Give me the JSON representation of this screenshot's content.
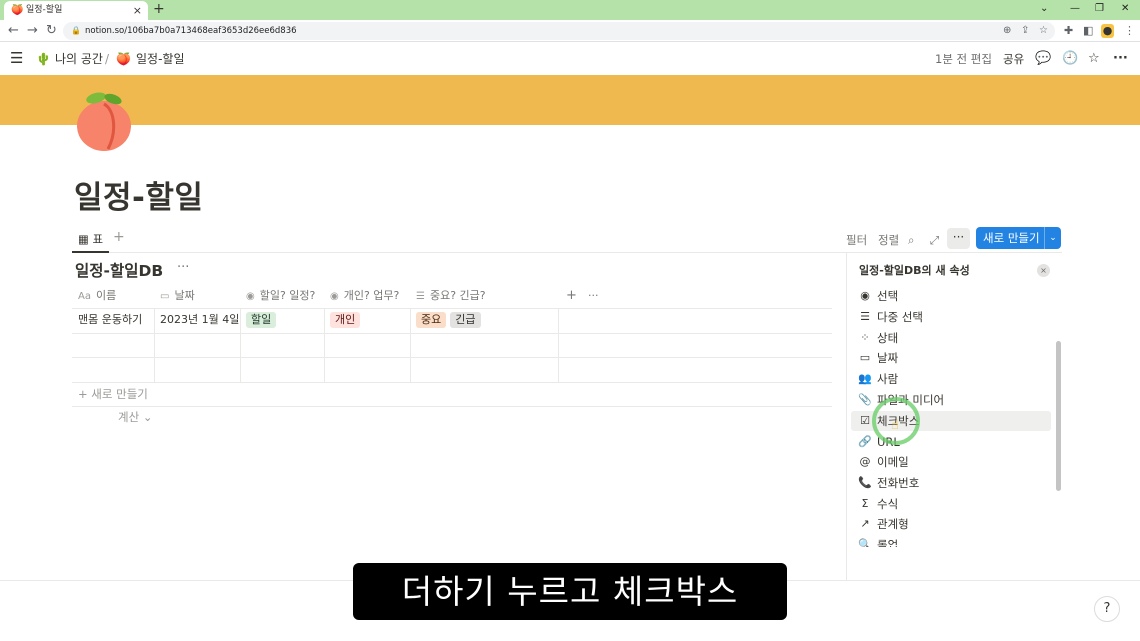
{
  "browser": {
    "tab_title": "일정-할일",
    "tab_favicon": "🍑",
    "new_tab": "+",
    "tab_close": "×",
    "url": "notion.so/106ba7b0a713468eaf3653d26ee6d836",
    "window_controls": [
      "⌄",
      "—",
      "❐",
      "✕"
    ]
  },
  "topbar": {
    "breadcrumb_workspace_icon": "🌵",
    "breadcrumb_workspace": "나의 공간",
    "breadcrumb_sep": "/",
    "breadcrumb_page_icon": "🍑",
    "breadcrumb_page": "일정-할일",
    "edited": "1분 전 편집",
    "share": "공유"
  },
  "page": {
    "title": "일정-할일",
    "cover_color": "#f0b94f"
  },
  "views": {
    "active_tab": "표",
    "add": "+",
    "filter": "필터",
    "sort": "정렬",
    "more": "···",
    "new_button": "새로 만들기",
    "new_dropdown": "⌄"
  },
  "database": {
    "title": "일정-할일DB",
    "title_more": "···",
    "columns": [
      {
        "icon": "Aa",
        "label": "이름"
      },
      {
        "icon": "▭",
        "label": "날짜"
      },
      {
        "icon": "◉",
        "label": "할일? 일정?"
      },
      {
        "icon": "◉",
        "label": "개인? 업무?"
      },
      {
        "icon": "☰",
        "label": "중요? 긴급?"
      }
    ],
    "header_add": "+",
    "header_more": "···",
    "rows": [
      {
        "name": "맨몸 운동하기",
        "date": "2023년 1월 4일",
        "type_tag": "할일",
        "scope_tag": "개인",
        "priority_tags": [
          "중요",
          "긴급"
        ]
      }
    ],
    "new_row": "새로 만들기",
    "calc": "계산"
  },
  "panel": {
    "title": "일정-할일DB의 새 속성",
    "close": "×",
    "types": [
      {
        "icon": "◉",
        "label": "선택"
      },
      {
        "icon": "☰",
        "label": "다중 선택"
      },
      {
        "icon": "⁘",
        "label": "상태"
      },
      {
        "icon": "▭",
        "label": "날짜"
      },
      {
        "icon": "👥",
        "label": "사람"
      },
      {
        "icon": "📎",
        "label": "파일과 미디어"
      },
      {
        "icon": "☑",
        "label": "체크박스"
      },
      {
        "icon": "🔗",
        "label": "URL"
      },
      {
        "icon": "@",
        "label": "이메일"
      },
      {
        "icon": "📞",
        "label": "전화번호"
      },
      {
        "icon": "Σ",
        "label": "수식"
      },
      {
        "icon": "↗",
        "label": "관계형"
      },
      {
        "icon": "🔍",
        "label": "롤업"
      }
    ]
  },
  "subtitle": "더하기 누르고 체크박스",
  "help": "?"
}
